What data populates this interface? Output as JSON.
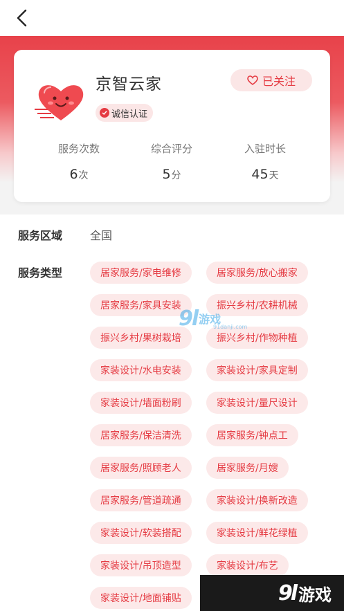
{
  "header": {
    "back_icon": "chevron-left-icon"
  },
  "shop": {
    "name": "京智云家",
    "logo_icon": "heart-face-icon",
    "cert_label": "诚信认证",
    "follow_label": "已关注",
    "follow_icon": "heart-outline-icon"
  },
  "stats": [
    {
      "label": "服务次数",
      "value": "6",
      "unit": "次"
    },
    {
      "label": "综合评分",
      "value": "5",
      "unit": "分"
    },
    {
      "label": "入驻时长",
      "value": "45",
      "unit": "天"
    }
  ],
  "service_area": {
    "label": "服务区域",
    "value": "全国"
  },
  "service_types": {
    "label": "服务类型",
    "tags": [
      "居家服务/家电维修",
      "居家服务/放心搬家",
      "居家服务/家具安装",
      "振兴乡村/农耕机械",
      "振兴乡村/果树栽培",
      "振兴乡村/作物种植",
      "家装设计/水电安装",
      "家装设计/家具定制",
      "家装设计/墙面粉刷",
      "家装设计/量尺设计",
      "居家服务/保洁清洗",
      "居家服务/钟点工",
      "居家服务/照顾老人",
      "居家服务/月嫂",
      "居家服务/管道疏通",
      "家装设计/换新改造",
      "家装设计/软装搭配",
      "家装设计/鲜花绿植",
      "家装设计/吊顶造型",
      "家装设计/布艺",
      "家装设计/地面铺贴"
    ]
  },
  "watermark": {
    "logo": "9l",
    "text": "游戏",
    "sub": "91danji.com"
  },
  "corner_watermark": {
    "logo": "9l",
    "text": "游戏"
  },
  "colors": {
    "accent": "#e53b43",
    "tag_bg": "#fce9e9",
    "hero": "#e8424a"
  }
}
